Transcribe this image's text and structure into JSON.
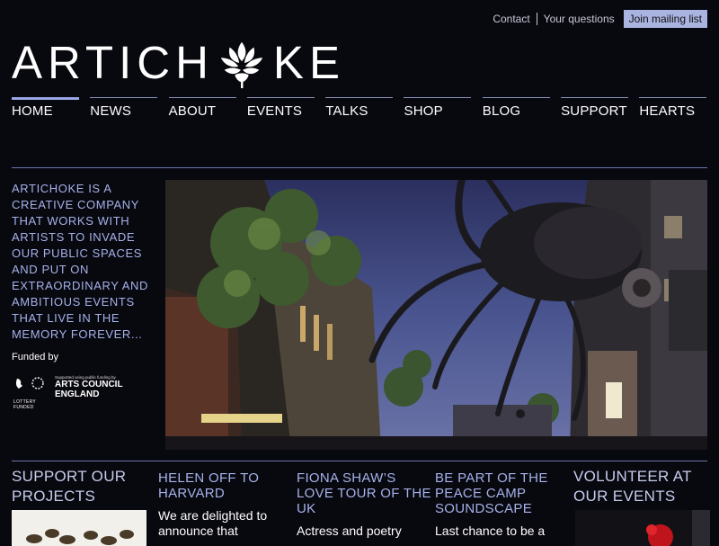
{
  "header": {
    "contact": "Contact",
    "questions": "Your questions",
    "mailing": "Join mailing list",
    "logo_left": "ARTICH",
    "logo_right": "KE"
  },
  "nav": {
    "items": [
      {
        "label": "HOME"
      },
      {
        "label": "NEWS"
      },
      {
        "label": "ABOUT"
      },
      {
        "label": "EVENTS"
      },
      {
        "label": "TALKS"
      },
      {
        "label": "SHOP"
      },
      {
        "label": "BLOG"
      },
      {
        "label": "SUPPORT"
      },
      {
        "label": "HEARTS"
      }
    ]
  },
  "intro": {
    "text": "ARTICHOKE IS A CREATIVE COMPANY THAT WORKS WITH ARTISTS TO INVADE OUR PUBLIC SPACES AND PUT ON EXTRAORDINARY AND AMBITIOUS EVENTS THAT LIVE IN THE MEMORY FOREVER...",
    "funded": "Funded by",
    "ac_small": "Supported using public funding by",
    "ac_line1": "ARTS COUNCIL",
    "ac_line2": "ENGLAND",
    "lottery": "LOTTERY FUNDED"
  },
  "columns": [
    {
      "heading": "SUPPORT OUR PROJECTS",
      "body": ""
    },
    {
      "heading": "HELEN OFF TO HARVARD",
      "body": "We are delighted to announce that"
    },
    {
      "heading": "FIONA SHAW’S LOVE TOUR OF THE UK",
      "body": "Actress and poetry"
    },
    {
      "heading": "BE PART OF THE PEACE CAMP SOUNDSCAPE",
      "body": "Last chance to be a"
    },
    {
      "heading": "VOLUNTEER AT OUR EVENTS",
      "body": ""
    }
  ],
  "colors": {
    "background": "#08080f",
    "accent": "#a6b2ea",
    "mailing_button": "#aab4e0"
  }
}
